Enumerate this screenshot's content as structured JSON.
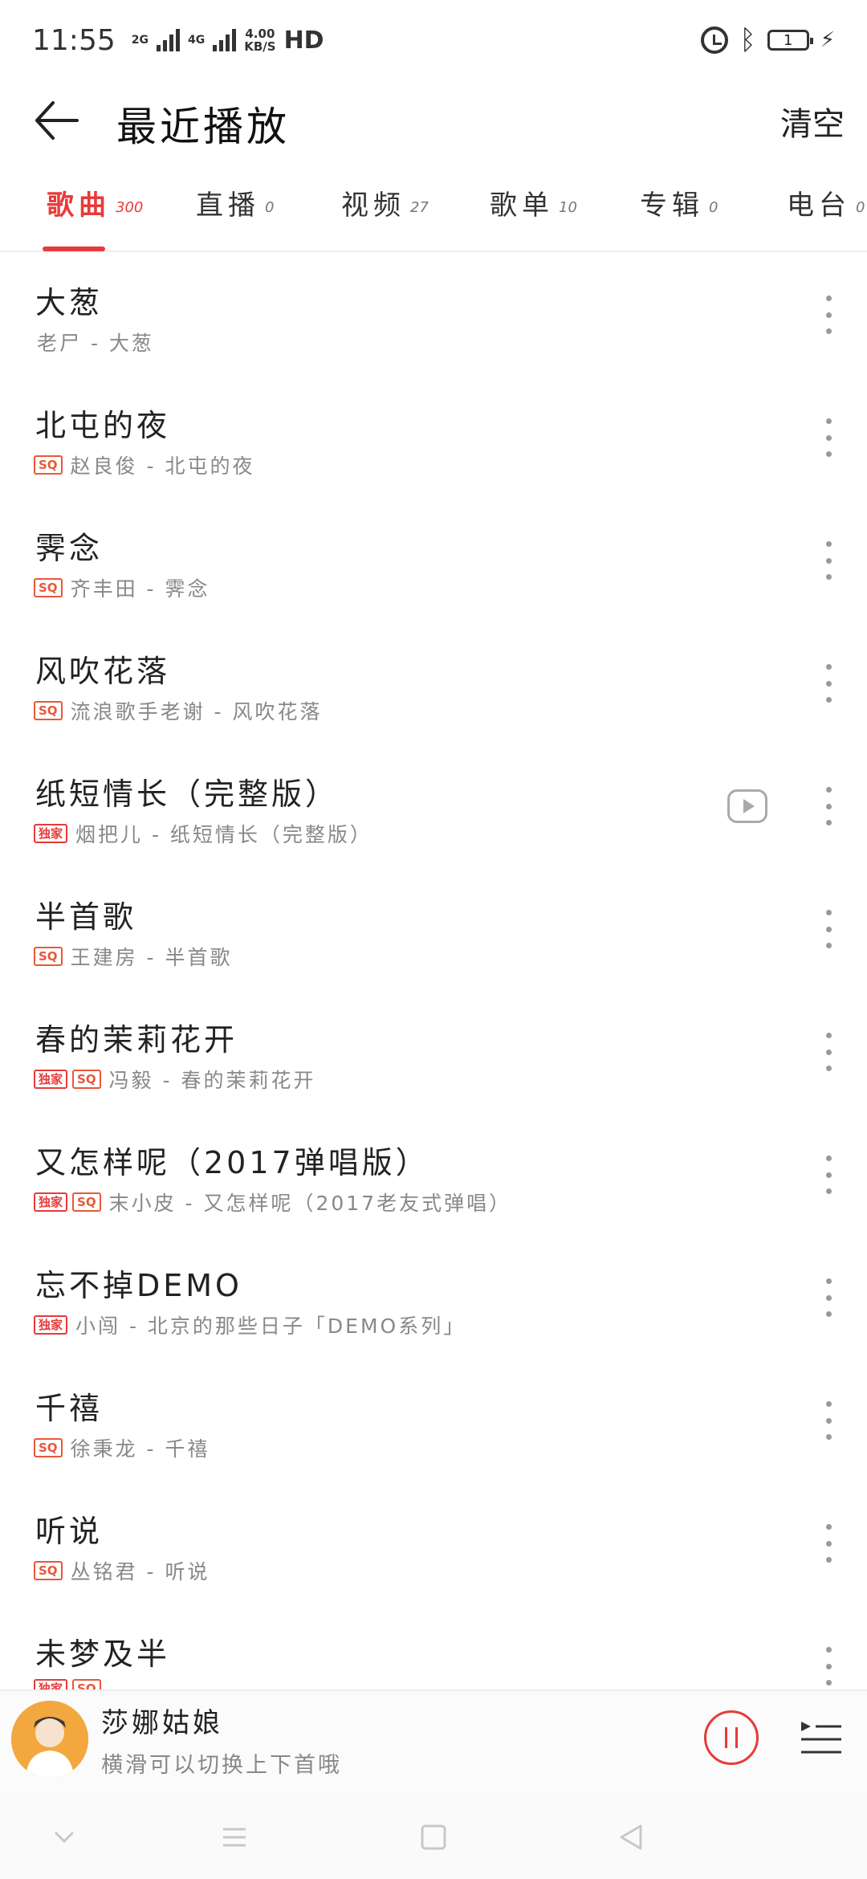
{
  "status_bar": {
    "time": "11:55",
    "net1": "2G",
    "net2": "4G",
    "speed_value": "4.00",
    "speed_unit": "KB/S",
    "hd": "HD",
    "battery": "1"
  },
  "header": {
    "title": "最近播放",
    "clear_label": "清空"
  },
  "tabs": [
    {
      "label": "歌曲",
      "count": "300"
    },
    {
      "label": "直播",
      "count": "0"
    },
    {
      "label": "视频",
      "count": "27"
    },
    {
      "label": "歌单",
      "count": "10"
    },
    {
      "label": "专辑",
      "count": "0"
    },
    {
      "label": "电台",
      "count": "0"
    }
  ],
  "badges": {
    "sq": "SQ",
    "exclusive": "独家"
  },
  "songs": [
    {
      "title": "大葱",
      "artist": "老尸 - 大葱"
    },
    {
      "title": "北屯的夜",
      "artist": "赵良俊 - 北屯的夜"
    },
    {
      "title": "霁念",
      "artist": "齐丰田 - 霁念"
    },
    {
      "title": "风吹花落",
      "artist": "流浪歌手老谢 - 风吹花落"
    },
    {
      "title": "纸短情长（完整版）",
      "artist": "烟把儿 - 纸短情长（完整版）"
    },
    {
      "title": "半首歌",
      "artist": "王建房 - 半首歌"
    },
    {
      "title": "春的茉莉花开",
      "artist": "冯毅 - 春的茉莉花开"
    },
    {
      "title": "又怎样呢（2017弹唱版）",
      "artist": "末小皮 - 又怎样呢（2017老友式弹唱）"
    },
    {
      "title": "忘不掉DEMO",
      "artist": "小闯 - 北京的那些日子「DEMO系列」"
    },
    {
      "title": "千禧",
      "artist": "徐秉龙 - 千禧"
    },
    {
      "title": "听说",
      "artist": "丛铭君 - 听说"
    },
    {
      "title": "未梦及半",
      "artist": ""
    }
  ],
  "now_playing": {
    "title": "莎娜姑娘",
    "hint": "横滑可以切换上下首哦"
  },
  "colors": {
    "accent": "#e83a3a",
    "sq_badge": "#e8583a"
  }
}
